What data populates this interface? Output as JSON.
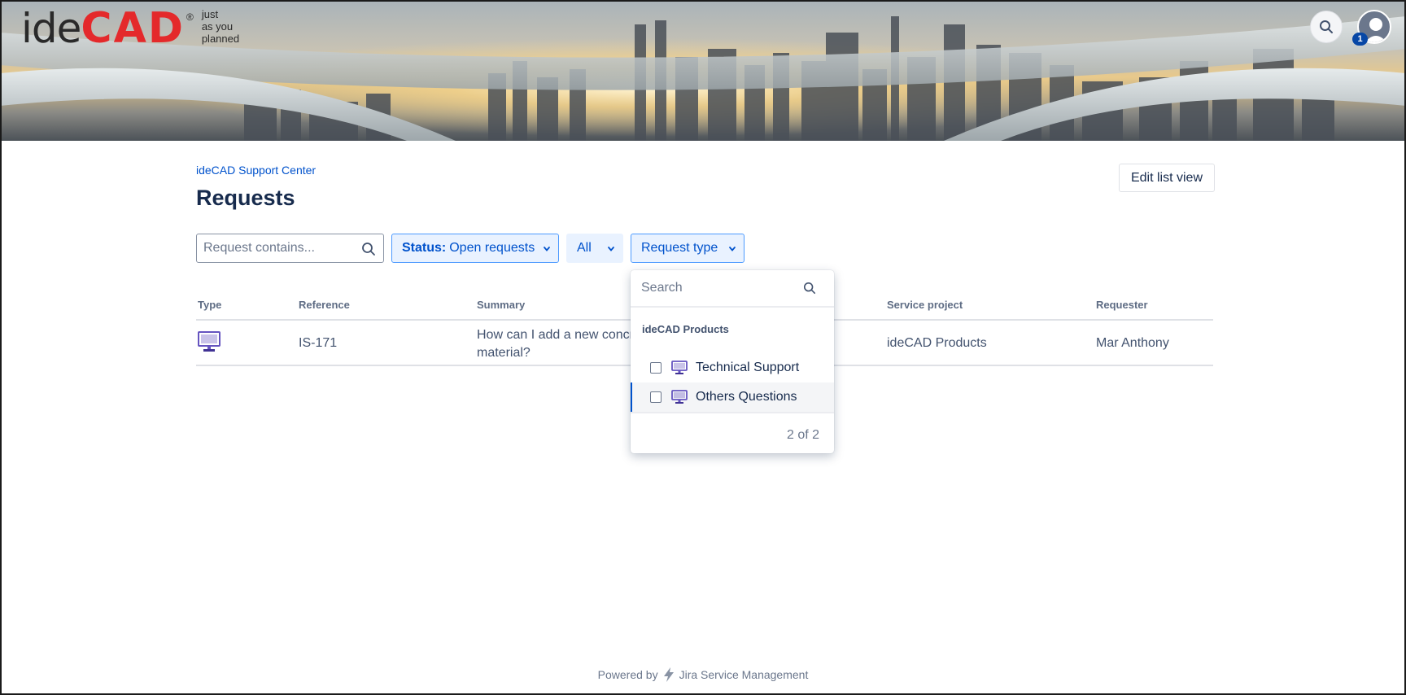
{
  "header": {
    "logo": {
      "part1": "ide",
      "part2": "CAD",
      "registered": "®",
      "tagline": [
        "just",
        "as you",
        "planned"
      ]
    },
    "search_icon": "search-icon",
    "avatar_icon": "user-avatar-icon",
    "notification_count": "1"
  },
  "breadcrumb": "ideCAD Support Center",
  "page_title": "Requests",
  "edit_button": "Edit list view",
  "filters": {
    "search_placeholder": "Request contains...",
    "status_label": "Status:",
    "status_value": "Open requests",
    "all_label": "All",
    "request_type_label": "Request type"
  },
  "table": {
    "columns": [
      "Type",
      "Reference",
      "Summary",
      "Service project",
      "Requester"
    ],
    "rows": [
      {
        "type_icon": "monitor-icon",
        "reference": "IS-171",
        "summary": "How can I add a new concr material?",
        "service_project": "ideCAD Products",
        "requester": "Mar Anthony"
      }
    ]
  },
  "dropdown": {
    "search_placeholder": "Search",
    "group_label": "ideCAD Products",
    "options": [
      {
        "label": "Technical Support",
        "checked": false
      },
      {
        "label": "Others Questions",
        "checked": false
      }
    ],
    "count": "2 of 2"
  },
  "footer": {
    "powered_by": "Powered by",
    "product": "Jira Service Management"
  },
  "colors": {
    "brand_red": "#e4292b",
    "link_blue": "#0052cc",
    "icon_purple": "#6554c0"
  }
}
